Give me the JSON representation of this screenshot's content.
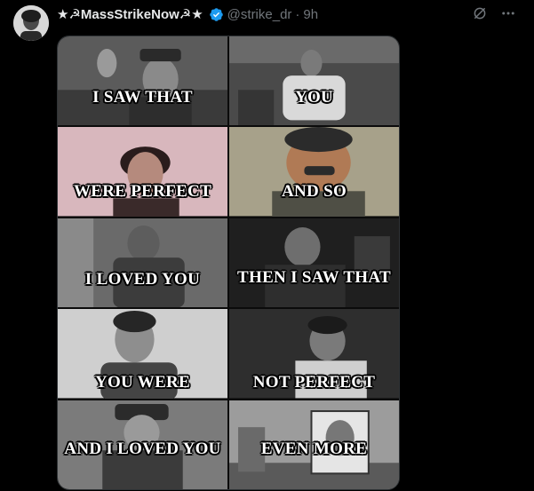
{
  "author": {
    "display_name": "★☭MassStrikeNow☭★",
    "handle": "@strike_dr",
    "separator": "·",
    "time": "9h",
    "verified_icon": "verified-badge-icon"
  },
  "header_icons": [
    "grok-icon",
    "more-icon"
  ],
  "colors": {
    "background": "#000000",
    "name": "#e7e9ea",
    "muted": "#71767b",
    "verified": "#1d9bf0",
    "border": "#2f3336"
  },
  "meme": {
    "panels": [
      {
        "caption": "I SAW THAT"
      },
      {
        "caption": "YOU"
      },
      {
        "caption": "WERE PERFECT"
      },
      {
        "caption": "AND SO"
      },
      {
        "caption": "I LOVED YOU"
      },
      {
        "caption": "THEN I SAW THAT"
      },
      {
        "caption": "YOU WERE"
      },
      {
        "caption": "NOT PERFECT"
      },
      {
        "caption": "AND I LOVED YOU"
      },
      {
        "caption": "EVEN MORE"
      }
    ]
  }
}
